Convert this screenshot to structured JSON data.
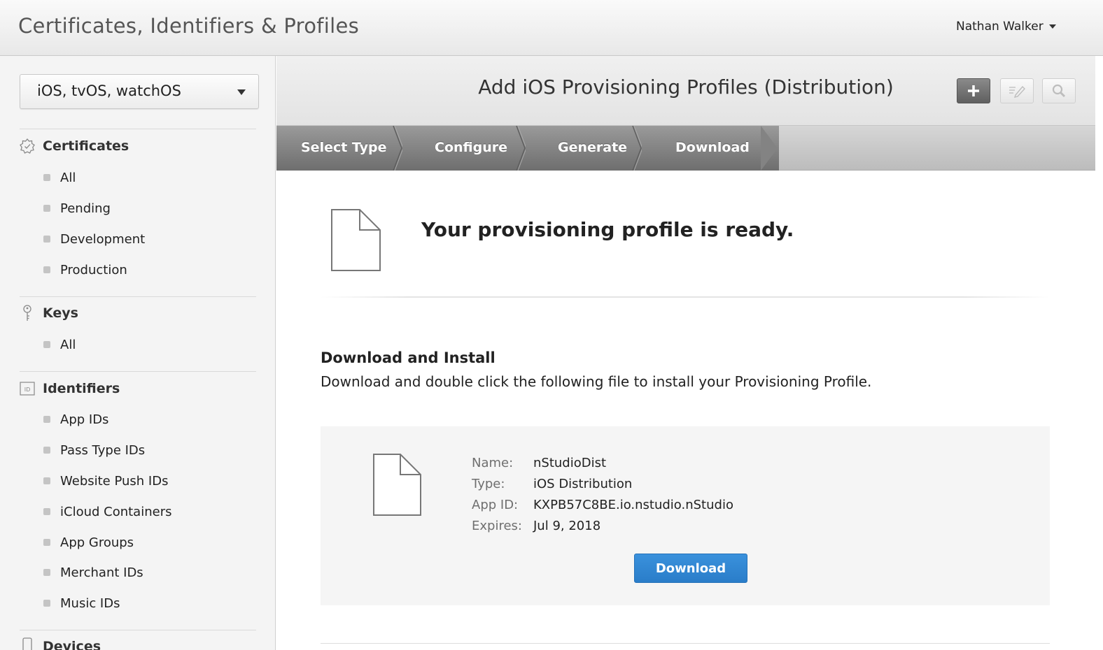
{
  "header": {
    "title": "Certificates, Identifiers & Profiles",
    "user_name": "Nathan Walker"
  },
  "sidebar": {
    "platform": "iOS, tvOS, watchOS",
    "sections": [
      {
        "title": "Certificates",
        "icon": "certificate-icon",
        "items": [
          "All",
          "Pending",
          "Development",
          "Production"
        ]
      },
      {
        "title": "Keys",
        "icon": "key-icon",
        "items": [
          "All"
        ]
      },
      {
        "title": "Identifiers",
        "icon": "id-badge-icon",
        "icon_text": "ID",
        "items": [
          "App IDs",
          "Pass Type IDs",
          "Website Push IDs",
          "iCloud Containers",
          "App Groups",
          "Merchant IDs",
          "Music IDs"
        ]
      },
      {
        "title": "Devices",
        "icon": "device-icon",
        "items": []
      }
    ]
  },
  "main": {
    "page_title": "Add iOS Provisioning Profiles (Distribution)",
    "toolbar": {
      "add_icon": "plus-icon",
      "edit_icon": "edit-icon",
      "search_icon": "search-icon"
    },
    "steps": [
      "Select Type",
      "Configure",
      "Generate",
      "Download"
    ],
    "current_step": "Download",
    "ready_message": "Your provisioning profile is ready.",
    "download_heading": "Download and Install",
    "download_description": "Download and double click the following file to install your Provisioning Profile.",
    "profile": {
      "name_label": "Name:",
      "name": "nStudioDist",
      "type_label": "Type:",
      "type": "iOS Distribution",
      "appid_label": "App ID:",
      "app_id": "KXPB57C8BE.io.nstudio.nStudio",
      "expires_label": "Expires:",
      "expires": "Jul 9, 2018"
    },
    "download_button": "Download"
  },
  "colors": {
    "primary_button": "#2a7dc9",
    "steps_active": "#7e7e7e",
    "sidebar_bg": "#f4f4f4"
  }
}
